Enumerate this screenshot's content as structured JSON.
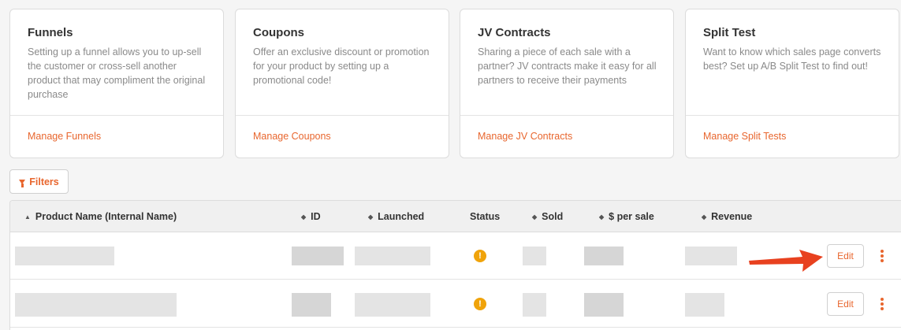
{
  "cards": [
    {
      "title": "Funnels",
      "description": "Setting up a funnel allows you to up-sell the customer or cross-sell another product that may compliment the original purchase",
      "link": "Manage Funnels"
    },
    {
      "title": "Coupons",
      "description": "Offer an exclusive discount or promotion for your product by setting up a promotional code!",
      "link": "Manage Coupons"
    },
    {
      "title": "JV Contracts",
      "description": "Sharing a piece of each sale with a partner? JV contracts make it easy for all partners to receive their payments",
      "link": "Manage JV Contracts"
    },
    {
      "title": "Split Test",
      "description": "Want to know which sales page converts best? Set up A/B Split Test to find out!",
      "link": "Manage Split Tests"
    }
  ],
  "filters_label": "Filters",
  "table": {
    "columns": {
      "product": "Product Name (Internal Name)",
      "id": "ID",
      "launched": "Launched",
      "status": "Status",
      "sold": "Sold",
      "per_sale": "$ per sale",
      "revenue": "Revenue"
    },
    "sort_asc_glyph": "▲",
    "sort_both_glyph": "◆",
    "status_glyph": "!",
    "edit_label": "Edit"
  },
  "colors": {
    "accent": "#e8662e",
    "status_warning": "#f0a30a",
    "annotation_arrow": "#e8411f"
  }
}
